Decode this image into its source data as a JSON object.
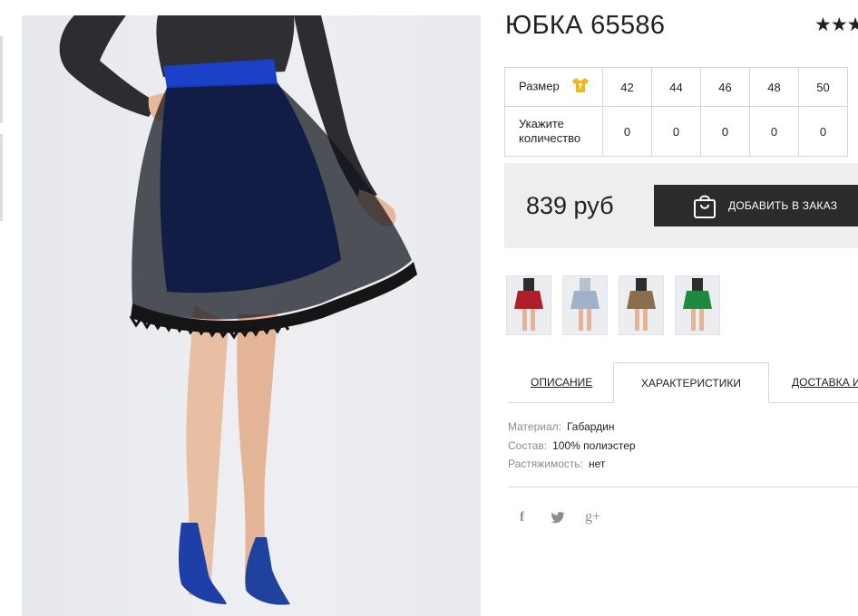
{
  "product": {
    "title": "ЮБКА 65586",
    "rating_display": "★★★"
  },
  "size_table": {
    "size_label": "Размер",
    "size_icon": "tshirt-icon",
    "quantity_label": "Укажите количество",
    "sizes": [
      "42",
      "44",
      "46",
      "48",
      "50"
    ],
    "quantities": [
      "0",
      "0",
      "0",
      "0",
      "0"
    ]
  },
  "purchase": {
    "price": "839 руб",
    "add_button_label": "ДОБАВИТЬ В ЗАКАЗ",
    "button_icon": "shopping-bag-icon"
  },
  "thumbnails": [
    {
      "color": "#b01e2a",
      "label": "red-skirt-variant"
    },
    {
      "color": "#9fb2c8",
      "label": "light-blue-skirt-variant"
    },
    {
      "color": "#c9a16a",
      "label": "beige-skirt-variant"
    },
    {
      "color": "#1f8a3c",
      "label": "green-skirt-variant"
    }
  ],
  "tabs": [
    {
      "label": "ОПИСАНИЕ",
      "active": false
    },
    {
      "label": "ХАРАКТЕРИСТИКИ",
      "active": true
    },
    {
      "label": "ДОСТАВКА И",
      "active": false
    }
  ],
  "characteristics": [
    {
      "key": "Материал:",
      "value": "Габардин"
    },
    {
      "key": "Состав:",
      "value": "100% полиэстер"
    },
    {
      "key": "Растяжимость:",
      "value": "нет"
    }
  ],
  "social": {
    "facebook": "f",
    "twitter_icon": "twitter-icon",
    "googleplus": "g+"
  },
  "colors": {
    "skirt_blue": "#1a3fc4",
    "button_dark": "#2b2b2b",
    "price_bg": "#eeeeee",
    "size_icon_yellow": "#f2b51a"
  }
}
